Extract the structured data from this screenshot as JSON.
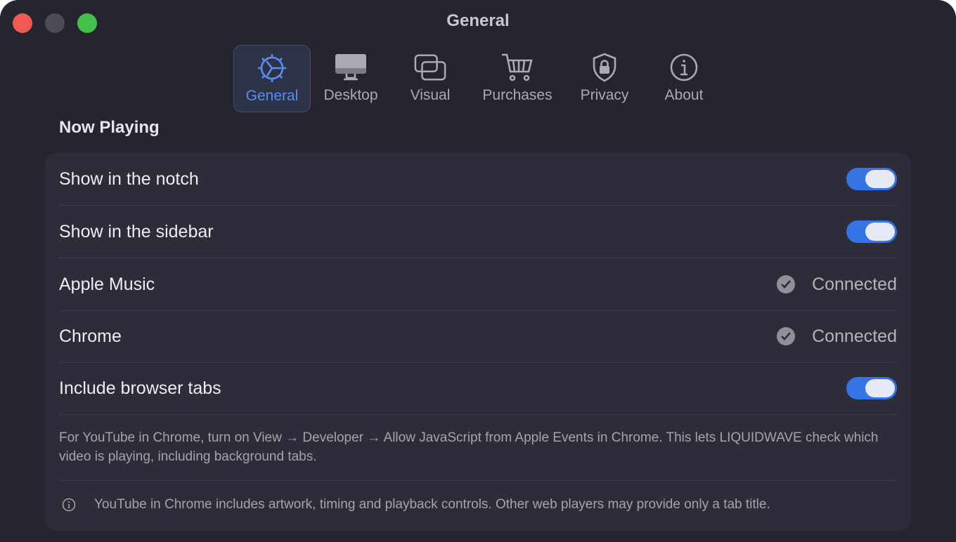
{
  "window": {
    "title": "General"
  },
  "tabs": [
    {
      "label": "General",
      "icon": "gear-icon",
      "active": true
    },
    {
      "label": "Desktop",
      "icon": "monitor-icon",
      "active": false
    },
    {
      "label": "Visual",
      "icon": "windows-icon",
      "active": false
    },
    {
      "label": "Purchases",
      "icon": "cart-icon",
      "active": false
    },
    {
      "label": "Privacy",
      "icon": "lock-shield-icon",
      "active": false
    },
    {
      "label": "About",
      "icon": "info-icon",
      "active": false
    }
  ],
  "section": {
    "title": "Now Playing"
  },
  "settings": [
    {
      "label": "Show in the notch",
      "control": "toggle",
      "on": true
    },
    {
      "label": "Show in the sidebar",
      "control": "toggle",
      "on": true
    },
    {
      "label": "Apple Music",
      "control": "status",
      "status": "Connected"
    },
    {
      "label": "Chrome",
      "control": "status",
      "status": "Connected"
    },
    {
      "label": "Include browser tabs",
      "control": "toggle",
      "on": true
    }
  ],
  "note": "For YouTube in Chrome, turn on View → Developer → Allow JavaScript from Apple Events in Chrome. This lets LIQUIDWAVE check which video is playing, including background tabs.",
  "info": "YouTube in Chrome includes artwork, timing and playback controls. Other web players may provide only a tab title.",
  "colors": {
    "accent": "#3674e6",
    "active_tab": "#5b8cf2",
    "close": "#ee5b54",
    "zoom": "#43c04a"
  }
}
